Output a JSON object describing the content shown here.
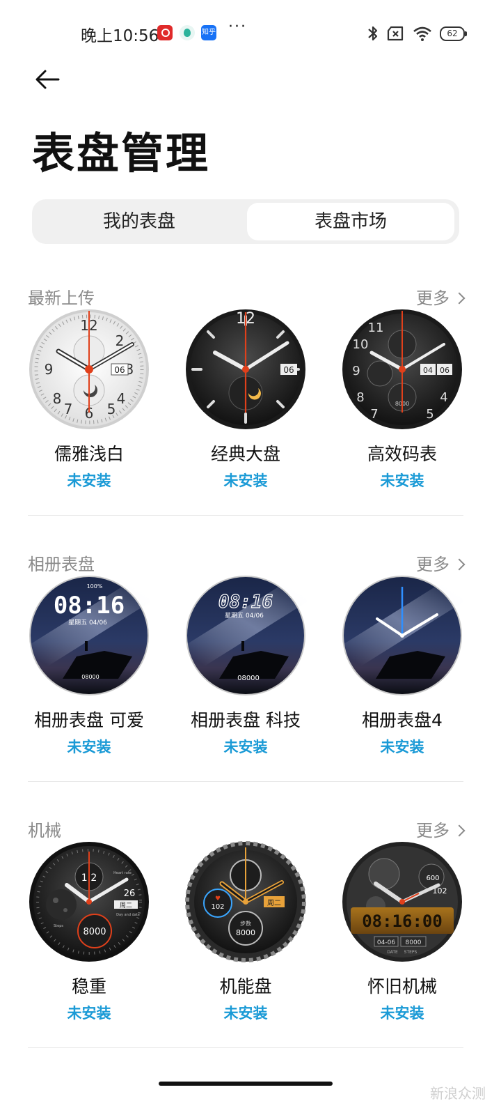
{
  "status_bar": {
    "time": "晚上10:56",
    "zhihu_label": "知乎",
    "more_dots": "···",
    "battery": "62"
  },
  "page": {
    "title": "表盘管理"
  },
  "tabs": [
    {
      "label": "我的表盘",
      "selected": false
    },
    {
      "label": "表盘市场",
      "selected": true
    }
  ],
  "sections": [
    {
      "header": "最新上传",
      "more": "更多",
      "items": [
        {
          "name": "儒雅浅白",
          "status": "未安装"
        },
        {
          "name": "经典大盘",
          "status": "未安装"
        },
        {
          "name": "高效码表",
          "status": "未安装"
        }
      ]
    },
    {
      "header": "相册表盘",
      "more": "更多",
      "items": [
        {
          "name": "相册表盘 可爱",
          "status": "未安装"
        },
        {
          "name": "相册表盘 科技",
          "status": "未安装"
        },
        {
          "name": "相册表盘4",
          "status": "未安装"
        }
      ]
    },
    {
      "header": "机械",
      "more": "更多",
      "items": [
        {
          "name": "稳重",
          "status": "未安装"
        },
        {
          "name": "机能盘",
          "status": "未安装"
        },
        {
          "name": "怀旧机械",
          "status": "未安装"
        }
      ]
    }
  ],
  "faces": {
    "white_date": "06",
    "classic_date": "06",
    "chrono_date_1": "04",
    "chrono_date_2": "06",
    "chrono_steps": "8000",
    "cute_battery": "100%",
    "cute_time": "08:16",
    "cute_date": "星期五 04/06",
    "cute_steps": "08000",
    "tech_time": "08:16",
    "tech_date": "星期五 04/06",
    "tech_steps": "08000",
    "steady_sub": "1|2",
    "steady_temp": "26",
    "steady_day": "周二",
    "steady_steps": "8000",
    "steady_hr_label": "Heart rate",
    "steady_day_label": "Day and date",
    "steady_steps_label": "Steps",
    "func_hr": "102",
    "func_day": "周二",
    "func_steps_label": "步数",
    "func_steps": "8000",
    "retro_time": "08:16:00",
    "retro_date": "04-06",
    "retro_steps": "8000",
    "retro_hr": "102",
    "retro_cal": "600",
    "retro_date_label": "DATE",
    "retro_steps_label": "STEPS"
  },
  "watermark": "新浪众测",
  "colors": {
    "accent_blue": "#1a9ad6",
    "hand_orange": "#e0401b",
    "tab_bg": "#f0f0f0"
  }
}
